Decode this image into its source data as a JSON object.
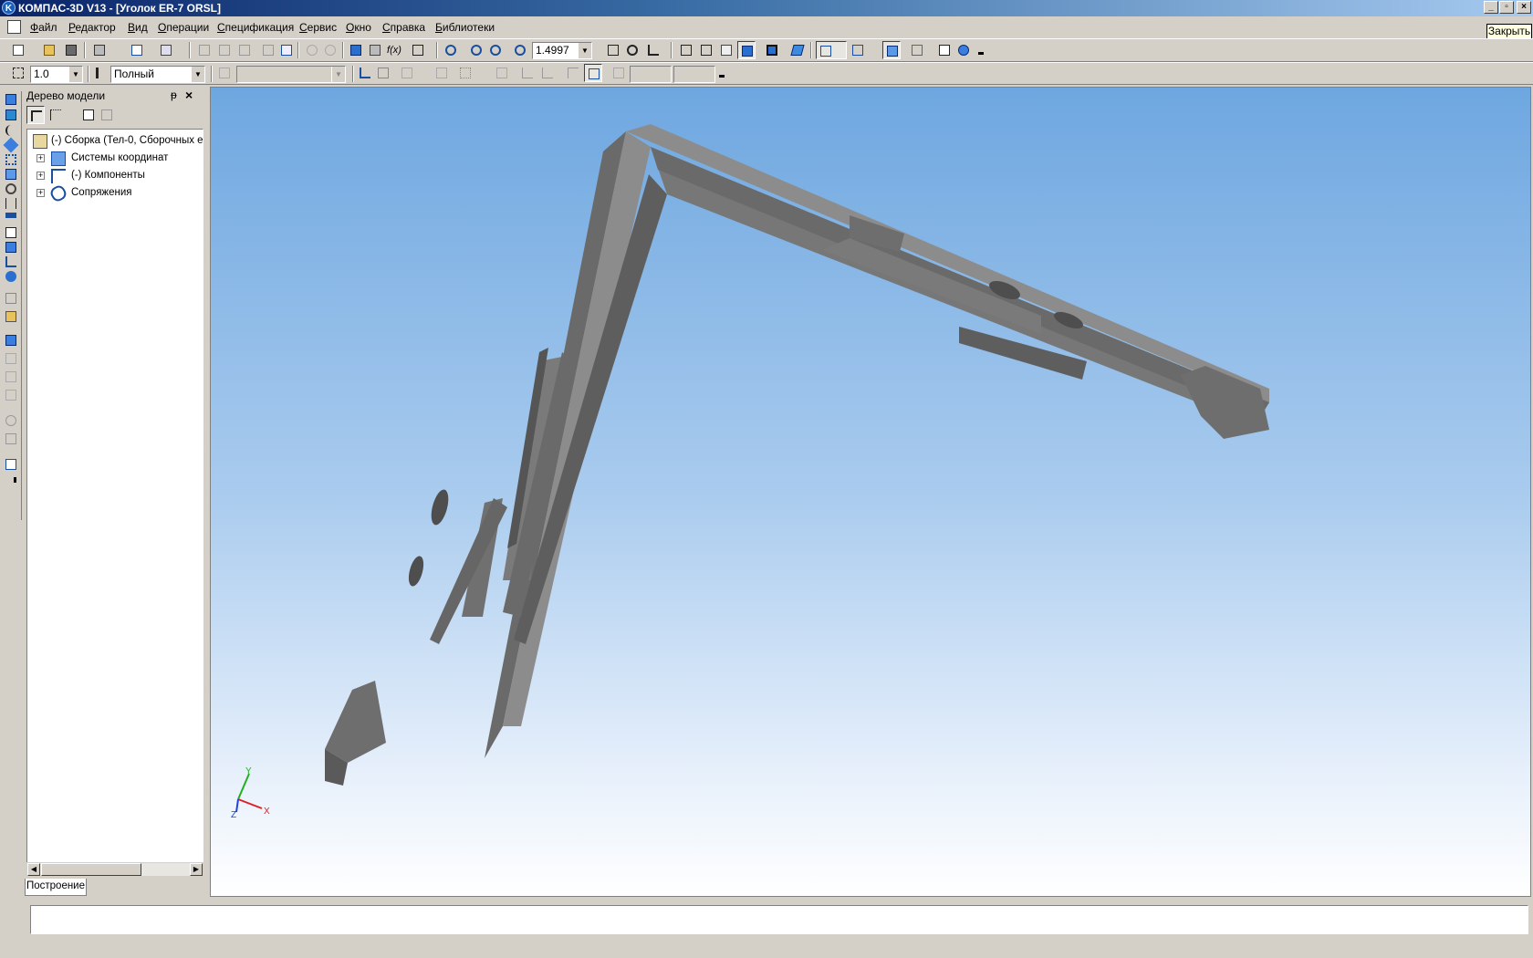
{
  "window": {
    "title": "КОМПАС-3D V13 - [Уголок ER-7 ORSL]",
    "controls": {
      "minimize": "_",
      "maximize": "▫",
      "close": "×"
    }
  },
  "menu": {
    "items": [
      "Файл",
      "Редактор",
      "Вид",
      "Операции",
      "Спецификация",
      "Сервис",
      "Окно",
      "Справка",
      "Библиотеки"
    ],
    "close_document_label": "Закрыть"
  },
  "toolbar_main": {
    "zoom_value": "1.4997",
    "fx_label": "f(x)"
  },
  "toolbar_current": {
    "step_value": "1.0",
    "style_value": "Полный",
    "layer_value": ""
  },
  "tree": {
    "title": "Дерево модели",
    "pin_glyph": "ᵽ",
    "close_glyph": "×",
    "root_label": "(-) Сборка (Тел-0, Сборочных е",
    "children": [
      {
        "label": "Системы координат",
        "expander": "+"
      },
      {
        "label": "(-) Компоненты",
        "expander": "+"
      },
      {
        "label": "Сопряжения",
        "expander": "+"
      }
    ],
    "tab_label": "Построение"
  },
  "axes": {
    "y": "Y",
    "x": "X",
    "z": "Z"
  },
  "colors": {
    "title_start": "#0a246a",
    "title_end": "#a6caf0",
    "face": "#d4d0c8",
    "model_top": "#8c8c8c",
    "model_side": "#5a5a5a",
    "model_front": "#787878",
    "axis_x": "#e02020",
    "axis_y": "#20b020",
    "axis_z": "#2040e0"
  }
}
